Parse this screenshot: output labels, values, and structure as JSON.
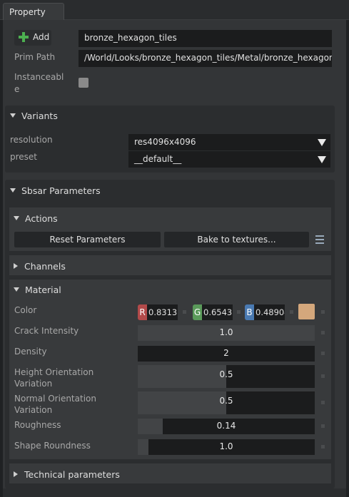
{
  "tab": {
    "label": "Property"
  },
  "prim": {
    "add_label": "Add",
    "name_value": "bronze_hexagon_tiles",
    "path_label": "Prim Path",
    "path_value": "/World/Looks/bronze_hexagon_tiles/Metal/bronze_hexagon_tiles",
    "instanceable_label_1": "Instanceabl",
    "instanceable_label_2": "e",
    "instanceable_checked": false
  },
  "variants": {
    "title": "Variants",
    "rows": [
      {
        "label": "resolution",
        "value": "res4096x4096"
      },
      {
        "label": "preset",
        "value": "__default__"
      }
    ]
  },
  "sbsar": {
    "title": "Sbsar Parameters",
    "actions": {
      "title": "Actions",
      "reset_label": "Reset Parameters",
      "bake_label": "Bake to textures..."
    },
    "channels_title": "Channels",
    "material": {
      "title": "Material",
      "color": {
        "label": "Color",
        "r": "0.83137",
        "g": "0.65431",
        "b": "0.48904",
        "r_letter": "R",
        "g_letter": "G",
        "b_letter": "B",
        "swatch": "#d4a77c",
        "r_color": "#b24a4a",
        "g_color": "#5a9a5a",
        "b_color": "#4a7ab2"
      },
      "params": [
        {
          "label": "Crack Intensity",
          "value": "1.0",
          "fill": 1.0
        },
        {
          "label": "Density",
          "value": "2",
          "fill": 0.0
        },
        {
          "label_1": "Height Orientation",
          "label_2": "Variation",
          "value": "0.5",
          "fill": 0.5
        },
        {
          "label_1": "Normal Orientation",
          "label_2": "Variation",
          "value": "0.5",
          "fill": 0.5
        },
        {
          "label": "Roughness",
          "value": "0.14",
          "fill": 0.14
        },
        {
          "label": "Shape Roundness",
          "value": "1.0",
          "fill": 0.06
        }
      ]
    },
    "technical_title": "Technical parameters"
  }
}
